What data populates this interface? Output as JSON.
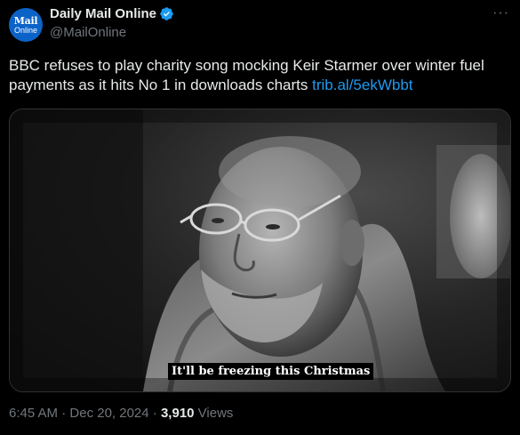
{
  "account": {
    "avatar_line1": "Mail",
    "avatar_line2": "Online",
    "display_name": "Daily Mail Online",
    "handle": "@MailOnline",
    "verified_color": "#1d9bf0"
  },
  "menu": {
    "more_label": "···"
  },
  "tweet": {
    "text": "BBC refuses to play charity song mocking Keir Starmer over winter fuel payments as it hits No 1 in downloads charts",
    "link": "trib.al/5ekWbbt"
  },
  "media": {
    "caption": "It'll be freezing this Christmas"
  },
  "meta": {
    "time": "6:45 AM",
    "separator1": " · ",
    "date": "Dec 20, 2024",
    "separator2": " · ",
    "views_count": "3,910",
    "views_label": " Views"
  },
  "colors": {
    "background": "#000000",
    "text": "#e7e9ea",
    "muted": "#71767b",
    "link": "#1d9bf0",
    "avatar_bg": "#0c63c7"
  }
}
